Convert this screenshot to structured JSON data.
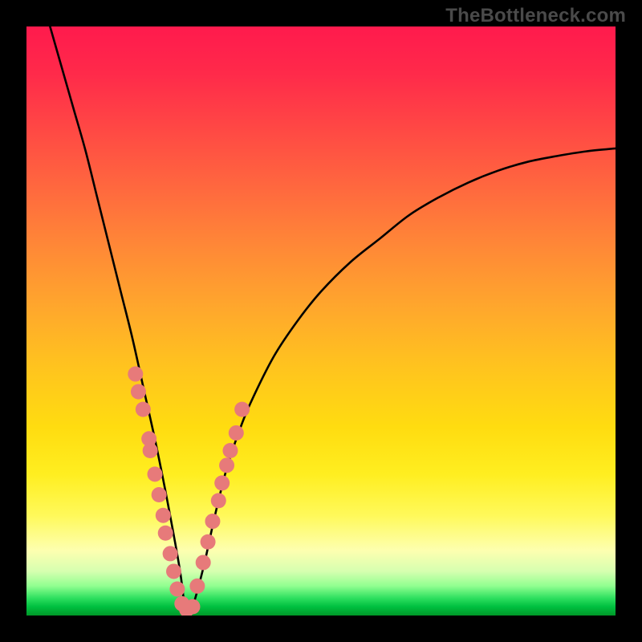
{
  "watermark": "TheBottleneck.com",
  "chart_data": {
    "type": "line",
    "title": "",
    "xlabel": "",
    "ylabel": "",
    "xlim": [
      0,
      100
    ],
    "ylim": [
      0,
      100
    ],
    "grid": false,
    "legend": false,
    "optimum_x": 27,
    "series": [
      {
        "name": "bottleneck-curve",
        "x": [
          4,
          6,
          8,
          10,
          12,
          14,
          16,
          18,
          20,
          22,
          24,
          26,
          27,
          28,
          30,
          32,
          34,
          36,
          38,
          42,
          46,
          50,
          55,
          60,
          65,
          70,
          75,
          80,
          85,
          90,
          95,
          100
        ],
        "y": [
          100,
          93,
          86,
          79,
          71,
          63,
          55,
          47,
          38,
          29,
          19,
          8,
          1,
          1,
          8,
          17,
          25,
          31,
          36,
          44,
          50,
          55,
          60,
          64,
          68,
          71,
          73.5,
          75.5,
          77,
          78,
          78.8,
          79.3
        ]
      }
    ],
    "dots_left": {
      "name": "left-branch-markers",
      "x": [
        18.5,
        19.0,
        19.8,
        20.8,
        21.0,
        21.8,
        22.5,
        23.2,
        23.6,
        24.4,
        25.0,
        25.6,
        26.4,
        27.2
      ],
      "y": [
        41.0,
        38.0,
        35.0,
        30.0,
        28.0,
        24.0,
        20.5,
        17.0,
        14.0,
        10.5,
        7.5,
        4.5,
        2.0,
        1.0
      ]
    },
    "dots_right": {
      "name": "right-branch-markers",
      "x": [
        28.2,
        29.0,
        30.0,
        30.8,
        31.6,
        32.6,
        33.2,
        34.0,
        34.6,
        35.6,
        36.6
      ],
      "y": [
        1.5,
        5.0,
        9.0,
        12.5,
        16.0,
        19.5,
        22.5,
        25.5,
        28.0,
        31.0,
        35.0
      ]
    }
  }
}
